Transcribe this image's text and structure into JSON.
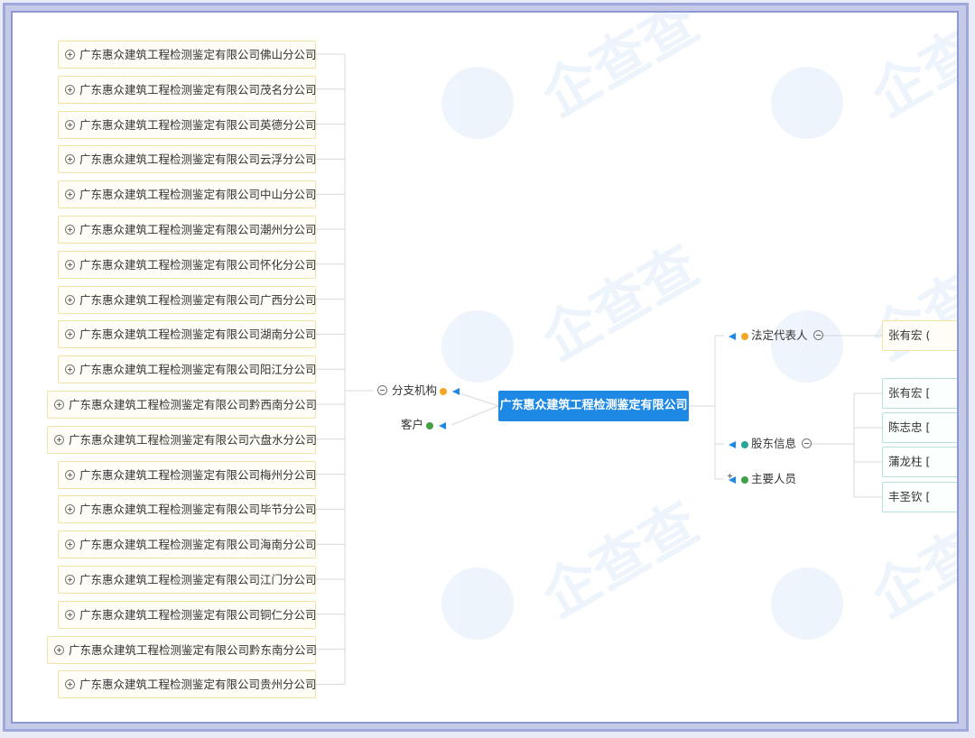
{
  "center": "广东惠众建筑工程检测鉴定有限公司",
  "categories": {
    "branches": "分支机构",
    "customers": "客户",
    "legal_rep": "法定代表人",
    "shareholders": "股东信息",
    "key_personnel": "主要人员"
  },
  "branches": [
    "广东惠众建筑工程检测鉴定有限公司佛山分公司",
    "广东惠众建筑工程检测鉴定有限公司茂名分公司",
    "广东惠众建筑工程检测鉴定有限公司英德分公司",
    "广东惠众建筑工程检测鉴定有限公司云浮分公司",
    "广东惠众建筑工程检测鉴定有限公司中山分公司",
    "广东惠众建筑工程检测鉴定有限公司潮州分公司",
    "广东惠众建筑工程检测鉴定有限公司怀化分公司",
    "广东惠众建筑工程检测鉴定有限公司广西分公司",
    "广东惠众建筑工程检测鉴定有限公司湖南分公司",
    "广东惠众建筑工程检测鉴定有限公司阳江分公司",
    "广东惠众建筑工程检测鉴定有限公司黔西南分公司",
    "广东惠众建筑工程检测鉴定有限公司六盘水分公司",
    "广东惠众建筑工程检测鉴定有限公司梅州分公司",
    "广东惠众建筑工程检测鉴定有限公司毕节分公司",
    "广东惠众建筑工程检测鉴定有限公司海南分公司",
    "广东惠众建筑工程检测鉴定有限公司江门分公司",
    "广东惠众建筑工程检测鉴定有限公司铜仁分公司",
    "广东惠众建筑工程检测鉴定有限公司黔东南分公司",
    "广东惠众建筑工程检测鉴定有限公司贵州分公司"
  ],
  "legal_rep": [
    "张有宏 ("
  ],
  "shareholders": [
    "张有宏 [",
    "陈志忠 [",
    "蒲龙柱 [",
    "丰圣钦 ["
  ],
  "colors": {
    "center": "#1e88e5",
    "branch_dot": "#f5a623",
    "customer_dot": "#43a047",
    "legal_dot": "#f5a623",
    "shareholder_dot": "#26a69a",
    "personnel_dot": "#43a047",
    "arrow": "#1e88e5"
  }
}
